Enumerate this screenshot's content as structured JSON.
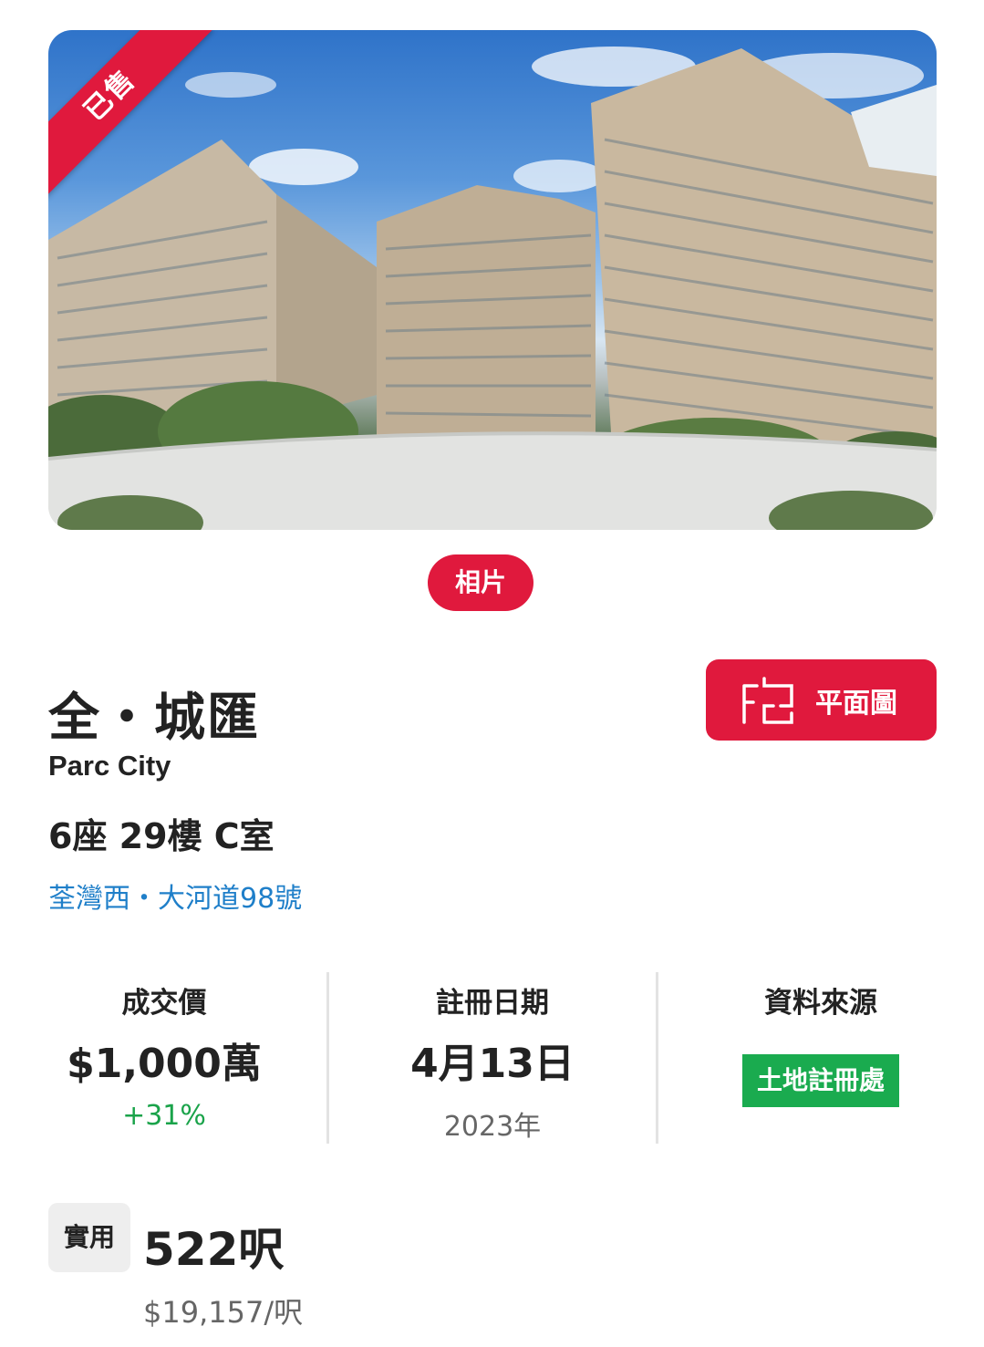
{
  "hero": {
    "sold_label": "已售"
  },
  "photo_button": {
    "label": "相片"
  },
  "property": {
    "name_zh": "全・城匯",
    "name_en": "Parc City",
    "unit": "6座 29樓 C室",
    "address": "荃灣西・大河道98號"
  },
  "floorplan_button": {
    "label": "平面圖",
    "icon": "floorplan-icon"
  },
  "stats": {
    "price": {
      "label": "成交價",
      "value": "$1,000萬",
      "change": "+31%"
    },
    "date": {
      "label": "註冊日期",
      "value": "4月13日",
      "year": "2023年"
    },
    "source": {
      "label": "資料來源",
      "badge": "土地註冊處"
    }
  },
  "area": {
    "tag": "實用",
    "value": "522呎",
    "price_per": "$19,157/呎"
  },
  "colors": {
    "accent": "#e0193d",
    "link": "#1f7fc9",
    "positive": "#1aa34a",
    "source_badge": "#1aab4f"
  }
}
